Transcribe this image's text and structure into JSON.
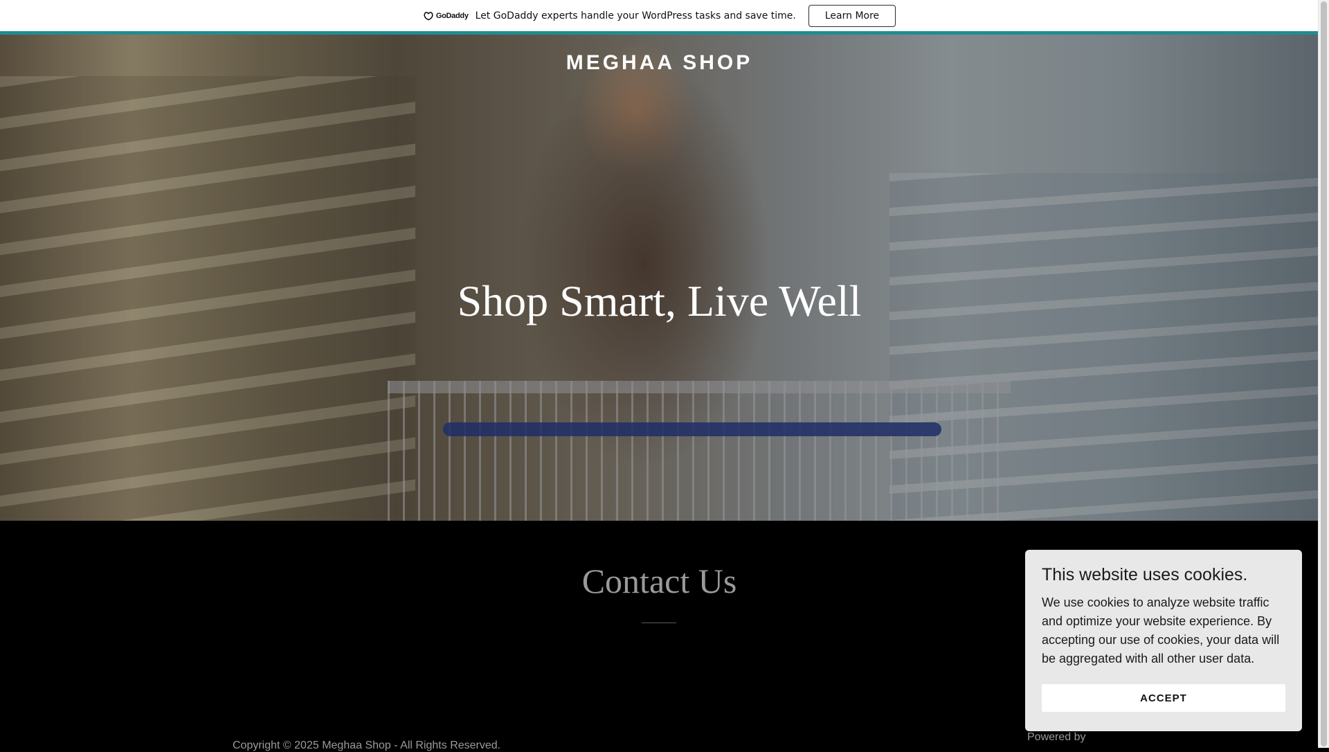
{
  "promo": {
    "logo_text": "GoDaddy",
    "message": "Let GoDaddy experts handle your WordPress tasks and save time.",
    "button_label": "Learn More"
  },
  "header": {
    "site_title": "MEGHAA SHOP"
  },
  "hero": {
    "tagline": "Shop Smart, Live Well"
  },
  "contact": {
    "title": "Contact Us"
  },
  "footer": {
    "copyright": "Copyright © 2025 Meghaa Shop - All Rights Reserved.",
    "powered_by": "Powered by"
  },
  "cookie_banner": {
    "title": "This website uses cookies.",
    "body": "We use cookies to analyze website traffic and optimize your website experience. By accepting our use of cookies, your data will be aggregated with all other user data.",
    "accept_label": "ACCEPT"
  },
  "colors": {
    "accent": "#1e8e92",
    "page_background": "#000000",
    "cookie_background": "#e8e8e8"
  }
}
